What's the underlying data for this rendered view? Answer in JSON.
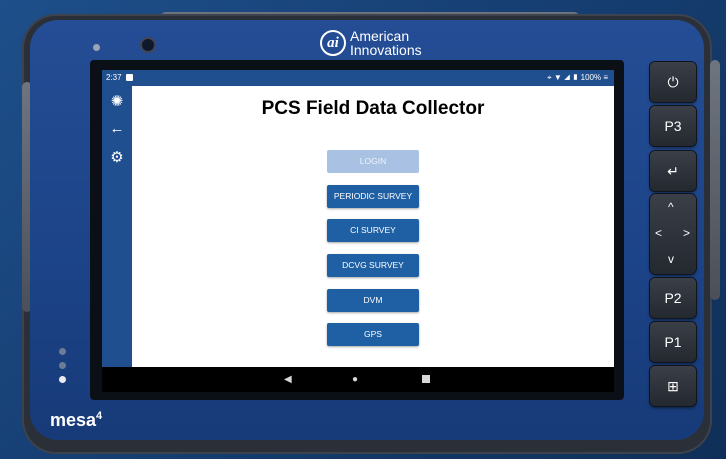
{
  "device": {
    "brand_line1": "American",
    "brand_line2": "Innovations",
    "model": "mesa",
    "model_sup": "4"
  },
  "status_bar": {
    "time": "2:37",
    "battery": "100%"
  },
  "app": {
    "title": "PCS Field Data Collector",
    "buttons": [
      {
        "label": "LOGIN",
        "enabled": false
      },
      {
        "label": "PERIODIC SURVEY",
        "enabled": true
      },
      {
        "label": "CI SURVEY",
        "enabled": true
      },
      {
        "label": "DCVG SURVEY",
        "enabled": true
      },
      {
        "label": "DVM",
        "enabled": true
      },
      {
        "label": "GPS",
        "enabled": true
      }
    ],
    "side_rail_icons": [
      "app-logo-icon",
      "back-arrow-icon",
      "gear-icon"
    ]
  },
  "hardware_keys": {
    "p3": "P3",
    "p2": "P2",
    "p1": "P1"
  },
  "colors": {
    "accent": "#1f5fa3",
    "accent_disabled": "#a9c2e3",
    "bar": "#1f4f8f"
  }
}
